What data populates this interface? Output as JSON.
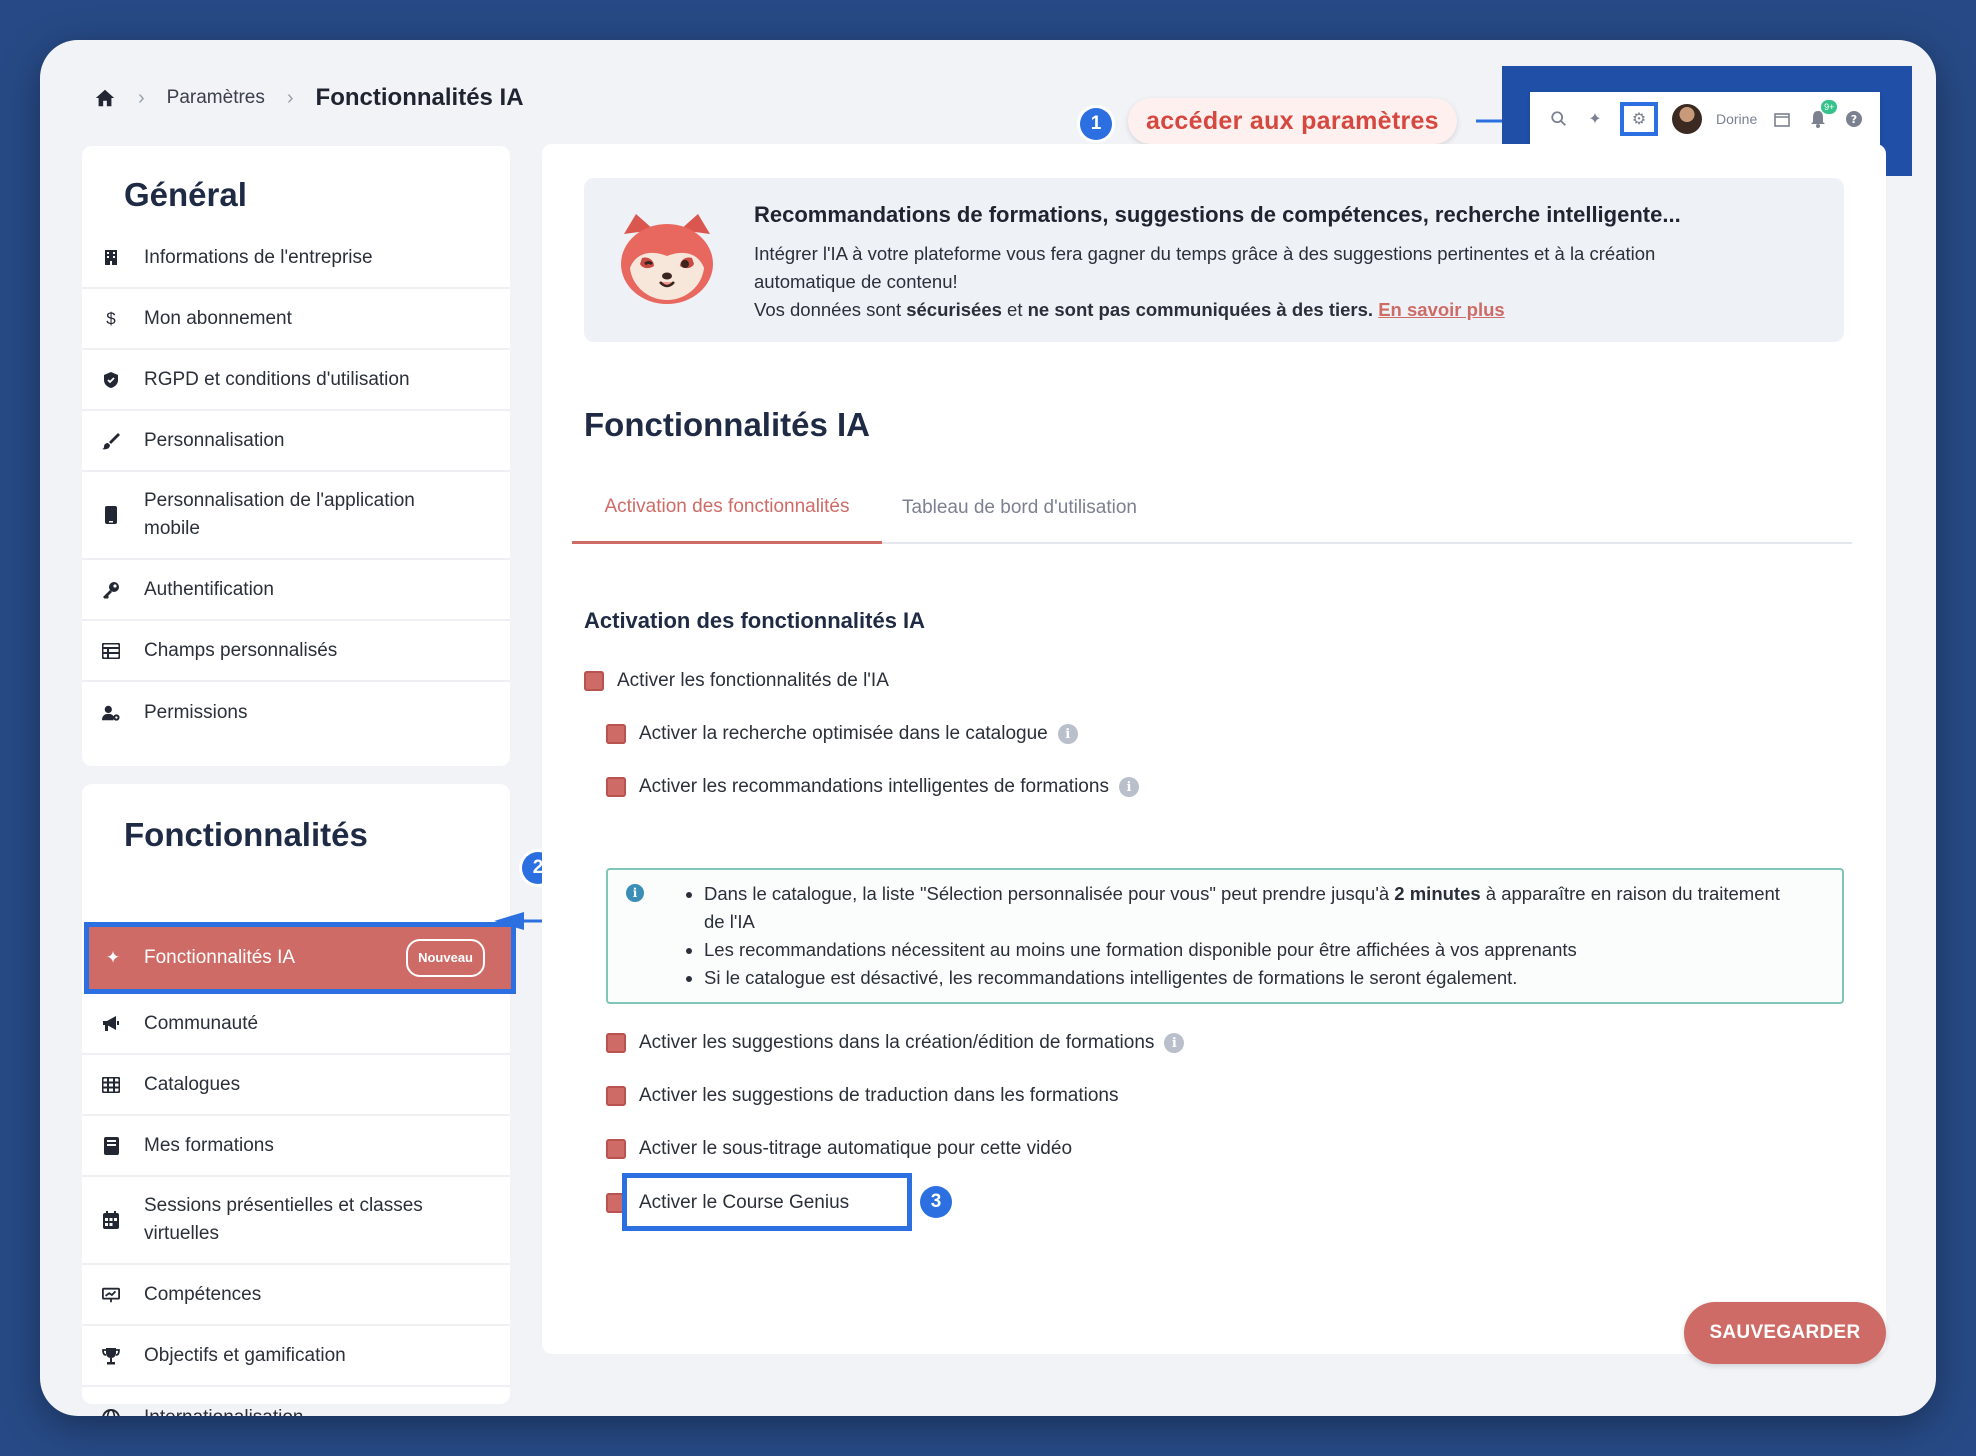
{
  "breadcrumb": {
    "parent": "Paramètres",
    "current": "Fonctionnalités IA"
  },
  "annotations": {
    "step1": "1",
    "step1_label": "accéder aux paramètres",
    "step2": "2",
    "step3": "3"
  },
  "topbar": {
    "user_name": "Dorine",
    "notif_count": "9+",
    "icons": [
      "search-icon",
      "sparkle-icon",
      "gear-icon",
      "avatar",
      "calendar-icon",
      "bell-icon",
      "help-icon"
    ]
  },
  "sidebar_general": {
    "title": "Général",
    "items": [
      {
        "label": "Informations de l'entreprise",
        "icon": "building-icon"
      },
      {
        "label": "Mon abonnement",
        "icon": "dollar-icon"
      },
      {
        "label": "RGPD et conditions d'utilisation",
        "icon": "shield-icon"
      },
      {
        "label": "Personnalisation",
        "icon": "brush-icon"
      },
      {
        "label": "Personnalisation de l'application mobile",
        "icon": "mobile-icon"
      },
      {
        "label": "Authentification",
        "icon": "key-icon"
      },
      {
        "label": "Champs personnalisés",
        "icon": "table-icon"
      },
      {
        "label": "Permissions",
        "icon": "user-gear-icon"
      }
    ]
  },
  "sidebar_features": {
    "title": "Fonctionnalités",
    "items": [
      {
        "label": "Fonctionnalités IA",
        "icon": "sparkle-icon",
        "badge": "Nouveau",
        "active": true
      },
      {
        "label": "Communauté",
        "icon": "megaphone-icon"
      },
      {
        "label": "Catalogues",
        "icon": "grid-icon"
      },
      {
        "label": "Mes formations",
        "icon": "book-icon"
      },
      {
        "label": "Sessions présentielles et classes virtuelles",
        "icon": "calendar-icon"
      },
      {
        "label": "Compétences",
        "icon": "chart-board-icon"
      },
      {
        "label": "Objectifs et gamification",
        "icon": "trophy-icon"
      },
      {
        "label": "Internationalisation",
        "icon": "globe-icon"
      }
    ]
  },
  "banner": {
    "title": "Recommandations de formations, suggestions de compétences, recherche intelligente...",
    "line1": "Intégrer l'IA à votre plateforme vous fera gagner du temps grâce à des suggestions pertinentes et à la création automatique de contenu!",
    "line2_pre": "Vos données sont ",
    "line2_b1": "sécurisées",
    "line2_mid": " et ",
    "line2_b2": "ne sont pas communiquées à des tiers.",
    "link": "En savoir plus"
  },
  "main": {
    "title": "Fonctionnalités IA",
    "tabs": [
      "Activation des fonctionnalités",
      "Tableau de bord d'utilisation"
    ],
    "section_title": "Activation des fonctionnalités IA",
    "options": {
      "master": "Activer les fonctionnalités de l'IA",
      "search": "Activer la recherche optimisée dans le catalogue",
      "reco": "Activer les recommandations intelligentes de formations",
      "suggest": "Activer les suggestions dans la création/édition de formations",
      "translate": "Activer les suggestions de traduction dans les formations",
      "subtitles": "Activer le sous-titrage automatique pour cette vidéo",
      "genius": "Activer le Course Genius"
    },
    "note": {
      "b1_pre": "Dans le catalogue, la liste \"Sélection personnalisée pour vous\" peut prendre jusqu'à ",
      "b1_bold": "2 minutes",
      "b1_post": " à apparaître en raison du traitement de l'IA",
      "b2": "Les recommandations nécessitent au moins une formation disponible pour être affichées à vos apprenants",
      "b3": "Si le catalogue est désactivé, les recommandations intelligentes de formations le seront également."
    },
    "save_label": "SAUVEGARDER"
  },
  "colors": {
    "accent": "#cf6b66",
    "annotation_blue": "#2b6fe0",
    "background": "#274a86"
  }
}
